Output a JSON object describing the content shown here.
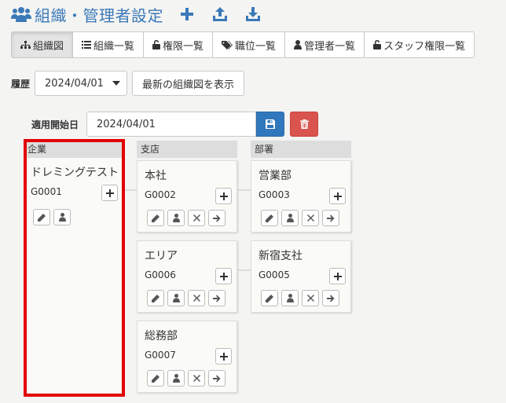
{
  "header": {
    "title": "組織・管理者設定",
    "icons": [
      "users-icon",
      "plus-icon",
      "upload-icon",
      "download-icon"
    ]
  },
  "tabs": [
    {
      "label": "組織図",
      "icon": "sitemap-icon",
      "active": true
    },
    {
      "label": "組織一覧",
      "icon": "list-icon",
      "active": false
    },
    {
      "label": "権限一覧",
      "icon": "unlock-icon",
      "active": false
    },
    {
      "label": "職位一覧",
      "icon": "tags-icon",
      "active": false
    },
    {
      "label": "管理者一覧",
      "icon": "user-icon",
      "active": false
    },
    {
      "label": "スタッフ権限一覧",
      "icon": "unlock-icon",
      "active": false
    }
  ],
  "history": {
    "label": "履歴",
    "selected": "2024/04/01",
    "latest_button": "最新の組織図を表示"
  },
  "start_date": {
    "label": "適用開始日",
    "value": "2024/04/01"
  },
  "columns": [
    {
      "header": "企業"
    },
    {
      "header": "支店"
    },
    {
      "header": "部署"
    }
  ],
  "company": {
    "name": "ドレミングテスト",
    "code": "G0001"
  },
  "branches": [
    {
      "name": "本社",
      "code": "G0002"
    },
    {
      "name": "エリア",
      "code": "G0006"
    },
    {
      "name": "総務部",
      "code": "G0007"
    }
  ],
  "departments": [
    {
      "name": "営業部",
      "code": "G0003"
    },
    {
      "name": "新宿支社",
      "code": "G0005"
    }
  ],
  "colors": {
    "accent": "#3a79b8",
    "save": "#3177bd",
    "delete": "#d9534f",
    "highlight": "#e30000"
  }
}
